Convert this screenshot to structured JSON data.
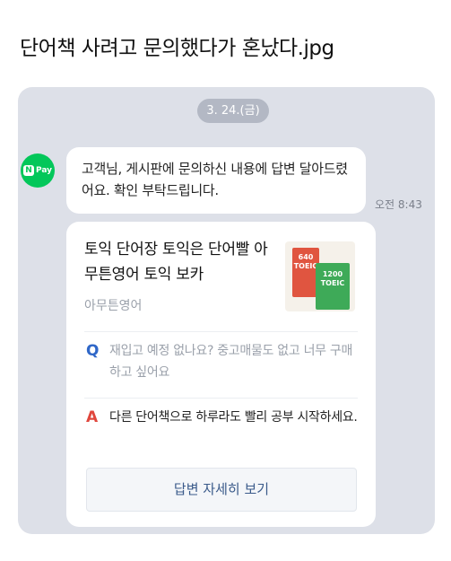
{
  "post": {
    "title": "단어책 사려고 문의했다가 혼났다.jpg"
  },
  "chat": {
    "date": "3. 24.(금)",
    "sender_badge": {
      "mark": "N",
      "label": "Pay"
    },
    "message": "고객님, 게시판에 문의하신 내용에 답변 달아드렸어요. 확인 부탁드립니다.",
    "time": "오전 8:43",
    "card": {
      "product_title": "토익 단어장 토익은 단어빨 아무튼영어 토익 보카",
      "seller": "아무튼영어",
      "thumbnail_text": {
        "red_book": "640 TOEIC",
        "green_book": "1200 TOEIC"
      },
      "question": {
        "mark": "Q",
        "text": "재입고 예정 없나요? 중고매물도 없고 너무 구매하고 싶어요"
      },
      "answer": {
        "mark": "A",
        "text": "다른 단어책으로 하루라도 빨리 공부 시작하세요."
      },
      "detail_button": "답변 자세히 보기"
    }
  }
}
